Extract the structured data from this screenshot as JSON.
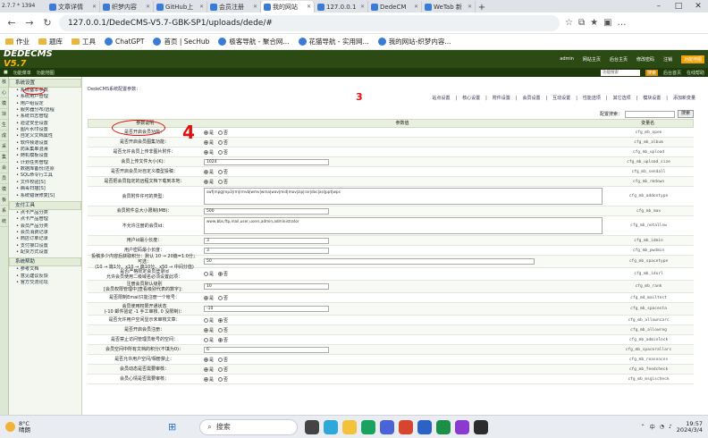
{
  "browser": {
    "dims_overlay": "2.7.7 * 1394",
    "tabs": [
      {
        "label": "文章详情"
      },
      {
        "label": "织梦内容"
      },
      {
        "label": "GitHub上"
      },
      {
        "label": "会员注册"
      },
      {
        "label": "我的网站",
        "active": true
      },
      {
        "label": "127.0.0.1"
      },
      {
        "label": "DedeCM"
      },
      {
        "label": "WeTab 新"
      }
    ],
    "url": "127.0.0.1/DedeCMS-V5.7-GBK-SP1/uploads/dede/#",
    "bookmarks": [
      "作业",
      "题库",
      "工具",
      "ChatGPT",
      "首页 | SecHub",
      "极客导航 - 聚合网...",
      "花猫导航 - 实用网...",
      "我的网站-织梦内容..."
    ]
  },
  "cms": {
    "logo_main": "DEDECMS",
    "logo_ver": "V5.7",
    "header_links": [
      "admin",
      "网站主页",
      "后台主页",
      "修改密码",
      "注销"
    ],
    "header_highlight": "功能地图",
    "toolbar_items": [
      "功能菜单",
      "功能地图"
    ],
    "search_placeholder": "功能搜索",
    "search_button": "搜索",
    "toolbar_right": [
      "后台首页",
      "在线帮助"
    ],
    "left_strip": [
      "核",
      "心",
      "模",
      "块",
      "生",
      "成",
      "采",
      "集",
      "会",
      "员",
      "模",
      "板",
      "系",
      "统"
    ]
  },
  "sidebar": {
    "groups": [
      {
        "title": "系统设置",
        "items": [
          "系统基本参数",
          "系统用户管理",
          "用户组设定",
          "服务器分布/远程",
          "系统日志管理",
          "验证安全设置",
          "图片水印设置",
          "自定义文档属性",
          "软件频道设置",
          "防采集串混淆",
          "随机模板设置",
          "计划任务管理",
          "数据库备份/还原",
          "SQL命令行工具",
          "文件校验[S]",
          "病毒扫描[S]",
          "系统错误修复[S]"
        ]
      },
      {
        "title": "支付工具",
        "items": [
          "点卡产品分类",
          "点卡产品管理",
          "会员产品分类",
          "会员消费记录",
          "商店订单记录",
          "支付接口设置",
          "配货方式设置"
        ]
      },
      {
        "title": "系统帮助",
        "items": [
          "参考文档",
          "意见建议反馈",
          "官方交流论坛"
        ]
      }
    ]
  },
  "main": {
    "breadcrumb": "DedeCMS系统配置参数：",
    "settings_tabs": [
      "站点设置",
      "核心设置",
      "附件设置",
      "会员设置",
      "互动设置",
      "性能选项",
      "其它选项",
      "模块设置",
      "添加新变量"
    ],
    "config_search_label": "配置搜索：",
    "config_search_button": "搜索",
    "col_headers": [
      "参数说明",
      "参数值",
      "变量名"
    ],
    "yes": "是",
    "no": "否",
    "rows": [
      {
        "label": "是否开启会员功能：",
        "type": "radio",
        "value": "yes",
        "var": "cfg_mb_open"
      },
      {
        "label": "是否开启会员图集功能：",
        "type": "radio",
        "value": "yes",
        "var": "cfg_mb_album"
      },
      {
        "label": "是否允许会员上传非图片附件：",
        "type": "radio",
        "value": "yes",
        "var": "cfg_mb_upload"
      },
      {
        "label": "会员上传文件大小(K)：",
        "type": "text",
        "value": "1024",
        "var": "cfg_mb_upload_size"
      },
      {
        "label": "是否开启会员对自定义模型投稿：",
        "type": "radio",
        "value": "yes",
        "var": "cfg_mb_sendall"
      },
      {
        "label": "是否把会员指定的远程文档下载到本地：",
        "type": "radio",
        "value": "yes",
        "var": "cfg_mb_rmdown"
      },
      {
        "label": "会员附件许可的类型：",
        "type": "textarea",
        "value": "swf|mpg|mp3|rm|rmvb|wmv|wma|wav|mid|mov|zip|rar|doc|xsl|ppt|wps",
        "var": "cfg_mb_addontype"
      },
      {
        "label": "会员附件总大小限制(MB)：",
        "type": "text",
        "value": "500",
        "var": "cfg_mb_max"
      },
      {
        "label": "不允许注册的会员id：",
        "type": "textarea",
        "value": "www,bbs,ftp,mail,user,users,admin,administrator",
        "var": "cfg_mb_notallow"
      },
      {
        "label": "用户id最小长度：",
        "type": "text",
        "value": "3",
        "var": "cfg_mb_idmin"
      },
      {
        "label": "用户密码最小长度：",
        "type": "text",
        "value": "3",
        "var": "cfg_mb_pwdmin"
      },
      {
        "label": "投稿多少内容后获取积分：默认 10 → 20篇=1.0分；可选：",
        "label2": "(10 → 篇1分、x10 → 篇10分、x50 → 中间分值)",
        "type": "text",
        "value": "50",
        "var": "cfg_mb_spacetype"
      },
      {
        "label": "是否严格限定会员登录id",
        "label2": "允许会员使用二级域名必须设置此项：",
        "type": "radio",
        "value": "no",
        "var": "cfg_mb_idurl"
      },
      {
        "label": "注册会员默认级别",
        "label2": "[会员权限管理中]查看级别代表的数字]：",
        "type": "text",
        "value": "10",
        "var": "cfg_mb_rank"
      },
      {
        "label": "是否限制Email只能注册一个帐号：",
        "type": "radio",
        "value": "yes",
        "var": "cfg_md_mailtest"
      },
      {
        "label": "会员使用权限开通状态",
        "label2": "(-10 邮件验证 -1 手工审核, 0 没限制)：",
        "type": "text",
        "value": "-10",
        "var": "cfg_mb_spacesta"
      },
      {
        "label": "是否允许用户空间显示未审核文章：",
        "type": "radio",
        "value": "no",
        "var": "cfg_mb_allowncarc"
      },
      {
        "label": "是否开启会员注册：",
        "type": "radio",
        "value": "yes",
        "var": "cfg_mb_allowreg"
      },
      {
        "label": "是否禁止访问管理员帐号的空间：",
        "type": "radio",
        "value": "no",
        "var": "cfg_mb_adminlock"
      },
      {
        "label": "会员空间中所有文档的积分(不填为0)：",
        "type": "text",
        "value": "6",
        "var": "cfg_mb_spacerallarc"
      },
      {
        "label": "是否允许用户空间/相册禁止：",
        "type": "radio",
        "value": "yes",
        "var": "cfg_mb_reasoncns"
      },
      {
        "label": "会员动态是否需要审核：",
        "type": "radio",
        "value": "yes",
        "var": "cfg_mb_feedcheck"
      },
      {
        "label": "会员心情是否需要审核：",
        "type": "radio",
        "value": "yes",
        "var": "cfg_mb_msgischeck"
      }
    ],
    "annotation_number": "4",
    "annotation_tab_mark": "3"
  },
  "taskbar": {
    "temperature": "8°C",
    "condition": "晴朗",
    "search_label": "搜索",
    "tray_lang": "中",
    "time": "19:57",
    "date": "2024/3/4"
  },
  "colors": {
    "header_bg": "#2c4a14",
    "toolbar_bg": "#1e3a0c",
    "annotation": "#e01010"
  }
}
